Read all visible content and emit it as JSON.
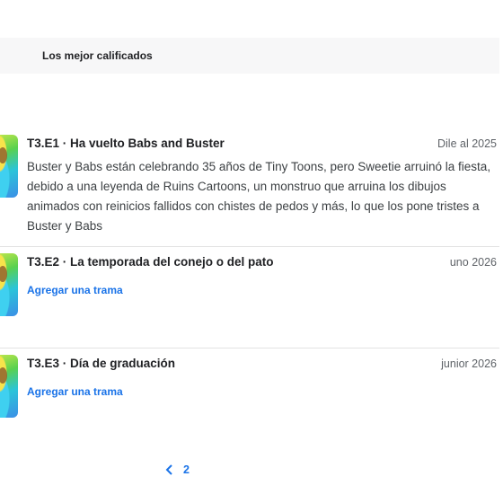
{
  "section": {
    "tab_label": "Los mejor calificados"
  },
  "episodes": [
    {
      "code_title": "T3.E1 · Ha vuelto Babs and Buster",
      "date": "Dile al 2025",
      "description": "Buster y Babs están celebrando 35 años de Tiny Toons, pero Sweetie arruinó la fiesta, debido a una leyenda de Ruins Cartoons, un monstruo que arruina los dibujos animados con reinicios fallidos con chistes de pedos y más, lo que los pone tristes a Buster y Babs"
    },
    {
      "code_title": "T3.E2 · La temporada del conejo o del pato",
      "date": "uno 2026",
      "add_plot": "Agregar una trama"
    },
    {
      "code_title": "T3.E3 · Día de graduación",
      "date": "junior 2026",
      "add_plot": "Agregar una trama"
    }
  ],
  "pagination": {
    "page": "2",
    "prev_icon": "chevron-left-icon"
  }
}
